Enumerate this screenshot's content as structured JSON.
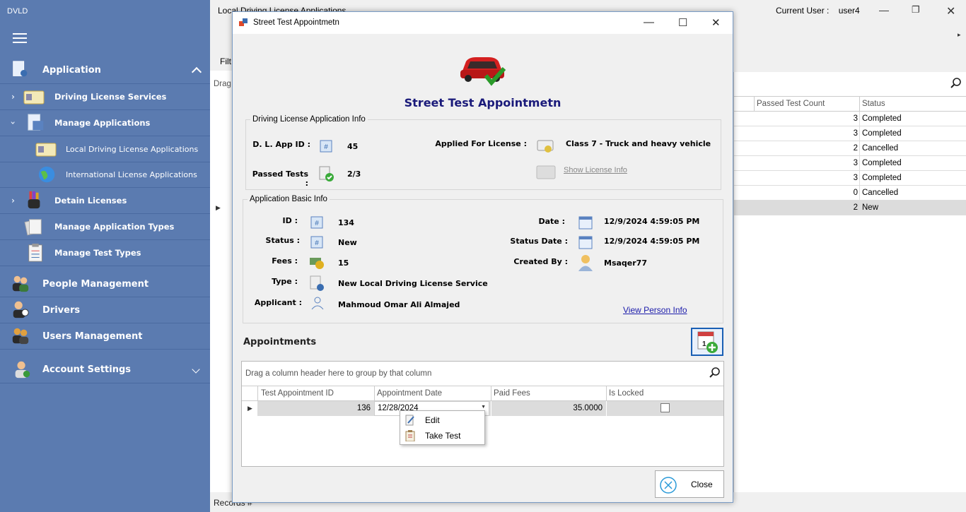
{
  "app": {
    "title": "DVLD"
  },
  "sidebar": {
    "items": [
      {
        "label": "Application",
        "icon": "document-user-icon"
      },
      {
        "label": "Driving License Services",
        "icon": "license-card-icon"
      },
      {
        "label": "Manage Applications",
        "icon": "applications-icon"
      },
      {
        "label": "Local Driving License Applications",
        "icon": "license-card-icon"
      },
      {
        "label": "International License Applications",
        "icon": "globe-icon"
      },
      {
        "label": "Detain Licenses",
        "icon": "hand-stop-icon"
      },
      {
        "label": "Manage Application Types",
        "icon": "papers-icon"
      },
      {
        "label": "Manage Test Types",
        "icon": "clipboard-icon"
      },
      {
        "label": "People Management",
        "icon": "people-icon"
      },
      {
        "label": "Drivers",
        "icon": "drivers-icon"
      },
      {
        "label": "Users Management",
        "icon": "users-icon"
      },
      {
        "label": "Account Settings",
        "icon": "account-gear-icon"
      }
    ]
  },
  "main": {
    "title": "Local Driving License Applications",
    "current_user_label": "Current User :",
    "current_user": "user4",
    "filter_label": "Filt",
    "drag_label": "Drag",
    "records_label": "Records #",
    "grid_headers": {
      "passed_test_count": "Passed Test Count",
      "status": "Status"
    },
    "rows": [
      {
        "count": "3",
        "status": "Completed"
      },
      {
        "count": "3",
        "status": "Completed"
      },
      {
        "count": "2",
        "status": "Cancelled"
      },
      {
        "count": "3",
        "status": "Completed"
      },
      {
        "count": "3",
        "status": "Completed"
      },
      {
        "count": "0",
        "status": "Cancelled"
      },
      {
        "count": "2",
        "status": "New"
      }
    ]
  },
  "dialog": {
    "window_title": "Street Test Appointmetn",
    "heading": "Street Test Appointmetn",
    "dl_group_title": "Driving License Application Info",
    "dl_app_id_label": "D. L. App ID :",
    "dl_app_id": "45",
    "applied_for_label": "Applied For License :",
    "applied_for": "Class 7 - Truck and heavy vehicle",
    "passed_tests_label": "Passed Tests :",
    "passed_tests": "2/3",
    "show_license_info": "Show License Info",
    "basic_group_title": "Application Basic Info",
    "id_label": "ID :",
    "id": "134",
    "status_label": "Status :",
    "status": "New",
    "fees_label": "Fees :",
    "fees": "15",
    "type_label": "Type :",
    "type": "New Local Driving License Service",
    "applicant_label": "Applicant :",
    "applicant": "Mahmoud Omar Ali Almajed",
    "date_label": "Date :",
    "date": "12/9/2024 4:59:05 PM",
    "status_date_label": "Status Date :",
    "status_date": "12/9/2024 4:59:05 PM",
    "created_by_label": "Created By :",
    "created_by": "Msaqer77",
    "view_person_info": "View Person Info",
    "appointments_title": "Appointments",
    "grid_drag_text": "Drag a column header here to group by that column",
    "grid_headers": {
      "test_appointment_id": "Test Appointment ID",
      "appointment_date": "Appointment Date",
      "paid_fees": "Paid Fees",
      "is_locked": "Is Locked"
    },
    "appointment_row": {
      "test_appointment_id": "136",
      "appointment_date": "12/28/2024",
      "paid_fees": "35.0000",
      "is_locked": false
    },
    "context_menu": {
      "edit": "Edit",
      "take_test": "Take Test"
    },
    "close_label": "Close"
  },
  "colors": {
    "sidebar": "#5b7bb0",
    "heading": "#1a1a7a",
    "link": "#1a1aaa"
  }
}
